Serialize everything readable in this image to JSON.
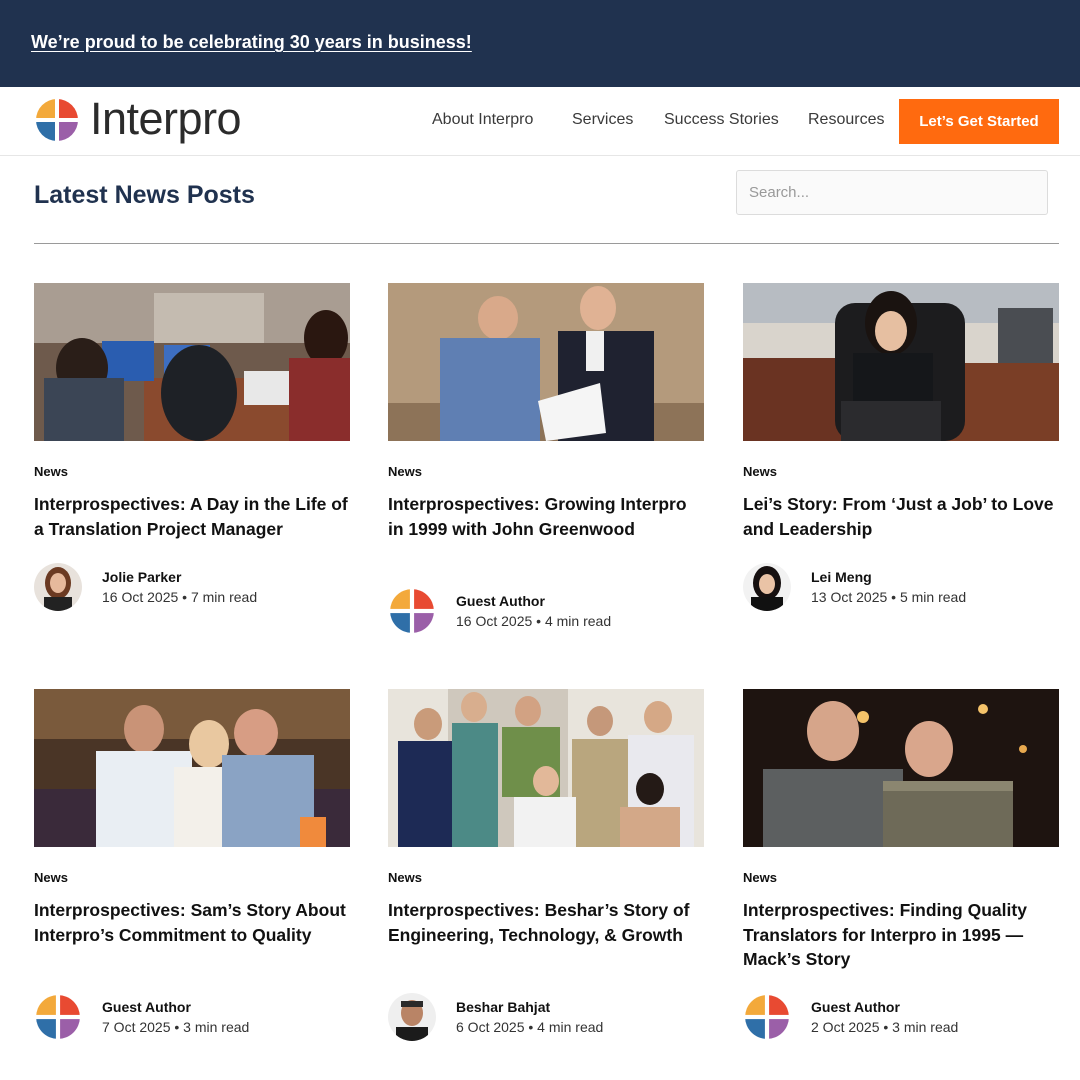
{
  "banner": {
    "text": "We’re proud to be celebrating 30 years in business!"
  },
  "brand": {
    "name": "Interpro",
    "logo_colors": [
      "#e84a32",
      "#f3a93b",
      "#2f6fa8",
      "#9b5fa8"
    ]
  },
  "nav": {
    "items": [
      "About Interpro",
      "Services",
      "Success Stories",
      "Resources"
    ],
    "cta": "Let’s Get Started"
  },
  "colors": {
    "navy": "#20324f",
    "orange": "#ff6a0f"
  },
  "page": {
    "heading": "Latest News Posts"
  },
  "search": {
    "placeholder": "Search..."
  },
  "posts": [
    {
      "category": "News",
      "title": "Interprospectives: A Day in the Life of a Translation Project Manager",
      "author": "Jolie Parker",
      "meta": "16 Oct 2025 • 7 min read",
      "avatar": "photo"
    },
    {
      "category": "News",
      "title": "Interprospectives: Growing Interpro in 1999 with John Greenwood",
      "author": "Guest Author",
      "meta": "16 Oct 2025 • 4 min read",
      "avatar": "logo"
    },
    {
      "category": "News",
      "title": "Lei’s Story: From ‘Just a Job’ to Love and Leadership",
      "author": "Lei Meng",
      "meta": "13 Oct 2025 • 5 min read",
      "avatar": "photo"
    },
    {
      "category": "News",
      "title": "Interprospectives: Sam’s Story About Interpro’s Commitment to Quality",
      "author": "Guest Author",
      "meta": "7 Oct 2025 • 3 min read",
      "avatar": "logo"
    },
    {
      "category": "News",
      "title": "Interprospectives: Beshar’s Story of Engineering, Technology, & Growth",
      "author": "Beshar Bahjat",
      "meta": "6 Oct 2025 • 4 min read",
      "avatar": "photo"
    },
    {
      "category": "News",
      "title": "Interprospectives: Finding Quality Translators for Interpro in 1995 — Mack’s Story",
      "author": "Guest Author",
      "meta": "2 Oct 2025 • 3 min read",
      "avatar": "logo"
    }
  ]
}
